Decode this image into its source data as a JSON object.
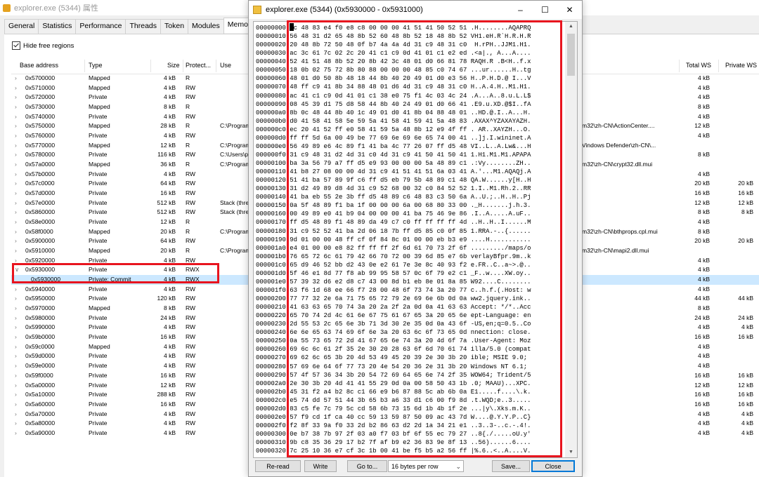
{
  "props": {
    "title": "explorer.exe (5344) 属性",
    "tabs": [
      "General",
      "Statistics",
      "Performance",
      "Threads",
      "Token",
      "Modules",
      "Memory"
    ],
    "hide_free_regions": "Hide free regions",
    "columns": {
      "base": "Base address",
      "type": "Type",
      "size": "Size",
      "protect": "Protect...",
      "use": "Use",
      "total_ws": "Total WS",
      "private_ws": "Private WS"
    },
    "rows": [
      {
        "c": ">",
        "a": "0x5700000",
        "t": "Mapped",
        "s": "4 kB",
        "p": "R",
        "u": "",
        "x": "",
        "tw": "4 kB",
        "pw": ""
      },
      {
        "c": ">",
        "a": "0x5710000",
        "t": "Mapped",
        "s": "4 kB",
        "p": "RW",
        "u": "",
        "x": "",
        "tw": "4 kB",
        "pw": ""
      },
      {
        "c": ">",
        "a": "0x5720000",
        "t": "Private",
        "s": "4 kB",
        "p": "RW",
        "u": "",
        "x": "",
        "tw": "4 kB",
        "pw": ""
      },
      {
        "c": ">",
        "a": "0x5730000",
        "t": "Mapped",
        "s": "8 kB",
        "p": "R",
        "u": "",
        "x": "",
        "tw": "8 kB",
        "pw": ""
      },
      {
        "c": ">",
        "a": "0x5740000",
        "t": "Private",
        "s": "4 kB",
        "p": "RW",
        "u": "",
        "x": "",
        "tw": "4 kB",
        "pw": ""
      },
      {
        "c": ">",
        "a": "0x5750000",
        "t": "Mapped",
        "s": "28 kB",
        "p": "R",
        "u": "C:\\Program",
        "x": "m32\\zh-CN\\ActionCenter....",
        "tw": "12 kB",
        "pw": ""
      },
      {
        "c": ">",
        "a": "0x5760000",
        "t": "Private",
        "s": "4 kB",
        "p": "RW",
        "u": "",
        "x": "",
        "tw": "4 kB",
        "pw": ""
      },
      {
        "c": ">",
        "a": "0x5770000",
        "t": "Mapped",
        "s": "12 kB",
        "p": "R",
        "u": "C:\\Program",
        "x": "Vindows Defender\\zh-CN\\...",
        "tw": "",
        "pw": ""
      },
      {
        "c": ">",
        "a": "0x5780000",
        "t": "Private",
        "s": "116 kB",
        "p": "RW",
        "u": "C:\\Users\\pa",
        "x": "",
        "tw": "8 kB",
        "pw": ""
      },
      {
        "c": ">",
        "a": "0x57a0000",
        "t": "Mapped",
        "s": "36 kB",
        "p": "R",
        "u": "C:\\Program",
        "x": "m32\\zh-CN\\crypt32.dll.mui",
        "tw": "",
        "pw": ""
      },
      {
        "c": ">",
        "a": "0x57b0000",
        "t": "Private",
        "s": "4 kB",
        "p": "RW",
        "u": "",
        "x": "",
        "tw": "4 kB",
        "pw": ""
      },
      {
        "c": ">",
        "a": "0x57c0000",
        "t": "Private",
        "s": "64 kB",
        "p": "RW",
        "u": "",
        "x": "",
        "tw": "20 kB",
        "pw": "20 kB"
      },
      {
        "c": ">",
        "a": "0x57d0000",
        "t": "Private",
        "s": "16 kB",
        "p": "RW",
        "u": "",
        "x": "",
        "tw": "16 kB",
        "pw": "16 kB"
      },
      {
        "c": ">",
        "a": "0x57e0000",
        "t": "Private",
        "s": "512 kB",
        "p": "RW",
        "u": "Stack (threa",
        "x": "",
        "tw": "12 kB",
        "pw": "12 kB"
      },
      {
        "c": ">",
        "a": "0x5860000",
        "t": "Private",
        "s": "512 kB",
        "p": "RW",
        "u": "Stack (threa",
        "x": "",
        "tw": "8 kB",
        "pw": "8 kB"
      },
      {
        "c": ">",
        "a": "0x58e0000",
        "t": "Private",
        "s": "12 kB",
        "p": "R",
        "u": "",
        "x": "",
        "tw": "4 kB",
        "pw": ""
      },
      {
        "c": ">",
        "a": "0x58f0000",
        "t": "Mapped",
        "s": "20 kB",
        "p": "R",
        "u": "C:\\Program",
        "x": "m32\\zh-CN\\bthprops.cpl.mui",
        "tw": "8 kB",
        "pw": ""
      },
      {
        "c": ">",
        "a": "0x5900000",
        "t": "Private",
        "s": "64 kB",
        "p": "RW",
        "u": "",
        "x": "",
        "tw": "20 kB",
        "pw": "20 kB"
      },
      {
        "c": ">",
        "a": "0x5910000",
        "t": "Mapped",
        "s": "20 kB",
        "p": "R",
        "u": "C:\\Program",
        "x": "m32\\zh-CN\\mapi2.dll.mui",
        "tw": "",
        "pw": ""
      },
      {
        "c": ">",
        "a": "0x5920000",
        "t": "Private",
        "s": "4 kB",
        "p": "RW",
        "u": "",
        "x": "",
        "tw": "4 kB",
        "pw": ""
      },
      {
        "c": "v",
        "a": "0x5930000",
        "t": "Private",
        "s": "4 kB",
        "p": "RWX",
        "u": "",
        "x": "",
        "tw": "4 kB",
        "pw": ""
      },
      {
        "c": "",
        "a": "0x5930000",
        "t": "Private: Commit",
        "s": "4 kB",
        "p": "RWX",
        "u": "",
        "x": "",
        "tw": "4 kB",
        "pw": "",
        "sel": true
      },
      {
        "c": ">",
        "a": "0x5940000",
        "t": "Private",
        "s": "4 kB",
        "p": "RW",
        "u": "",
        "x": "",
        "tw": "4 kB",
        "pw": ""
      },
      {
        "c": ">",
        "a": "0x5950000",
        "t": "Private",
        "s": "120 kB",
        "p": "RW",
        "u": "",
        "x": "",
        "tw": "44 kB",
        "pw": "44 kB"
      },
      {
        "c": ">",
        "a": "0x5970000",
        "t": "Mapped",
        "s": "8 kB",
        "p": "RW",
        "u": "",
        "x": "",
        "tw": "8 kB",
        "pw": ""
      },
      {
        "c": ">",
        "a": "0x5980000",
        "t": "Private",
        "s": "24 kB",
        "p": "RW",
        "u": "",
        "x": "",
        "tw": "24 kB",
        "pw": "24 kB"
      },
      {
        "c": ">",
        "a": "0x5990000",
        "t": "Private",
        "s": "4 kB",
        "p": "RW",
        "u": "",
        "x": "",
        "tw": "4 kB",
        "pw": "4 kB"
      },
      {
        "c": ">",
        "a": "0x59b0000",
        "t": "Private",
        "s": "16 kB",
        "p": "RW",
        "u": "",
        "x": "",
        "tw": "16 kB",
        "pw": "16 kB"
      },
      {
        "c": ">",
        "a": "0x59c0000",
        "t": "Mapped",
        "s": "4 kB",
        "p": "RW",
        "u": "",
        "x": "",
        "tw": "4 kB",
        "pw": ""
      },
      {
        "c": ">",
        "a": "0x59d0000",
        "t": "Private",
        "s": "4 kB",
        "p": "RW",
        "u": "",
        "x": "",
        "tw": "4 kB",
        "pw": ""
      },
      {
        "c": ">",
        "a": "0x59e0000",
        "t": "Private",
        "s": "4 kB",
        "p": "RW",
        "u": "",
        "x": "",
        "tw": "4 kB",
        "pw": ""
      },
      {
        "c": ">",
        "a": "0x59f0000",
        "t": "Private",
        "s": "16 kB",
        "p": "RW",
        "u": "",
        "x": "",
        "tw": "16 kB",
        "pw": "16 kB"
      },
      {
        "c": ">",
        "a": "0x5a00000",
        "t": "Private",
        "s": "12 kB",
        "p": "RW",
        "u": "",
        "x": "",
        "tw": "12 kB",
        "pw": "12 kB"
      },
      {
        "c": ">",
        "a": "0x5a10000",
        "t": "Private",
        "s": "288 kB",
        "p": "RW",
        "u": "",
        "x": "",
        "tw": "16 kB",
        "pw": "16 kB"
      },
      {
        "c": ">",
        "a": "0x5a60000",
        "t": "Private",
        "s": "16 kB",
        "p": "RW",
        "u": "",
        "x": "",
        "tw": "16 kB",
        "pw": "16 kB"
      },
      {
        "c": ">",
        "a": "0x5a70000",
        "t": "Private",
        "s": "4 kB",
        "p": "RW",
        "u": "",
        "x": "",
        "tw": "4 kB",
        "pw": "4 kB"
      },
      {
        "c": ">",
        "a": "0x5a80000",
        "t": "Private",
        "s": "4 kB",
        "p": "RW",
        "u": "",
        "x": "",
        "tw": "4 kB",
        "pw": "4 kB"
      },
      {
        "c": ">",
        "a": "0x5a90000",
        "t": "Private",
        "s": "4 kB",
        "p": "RW",
        "u": "",
        "x": "",
        "tw": "4 kB",
        "pw": "4 kB"
      }
    ]
  },
  "hex": {
    "title": "explorer.exe (5344) (0x5930000 - 0x5931000)",
    "lines": [
      "00000000 fc 48 83 e4 f0 e8 c8 00 00 00 41 51 41 50 52 51 .H........AQAPRQ",
      "00000010 56 48 31 d2 65 48 8b 52 60 48 8b 52 18 48 8b 52 VH1.eH.R`H.R.H.R",
      "00000020 20 48 8b 72 50 48 0f b7 4a 4a 4d 31 c9 48 31 c0  H.rPH..JJM1.H1.",
      "00000030 ac 3c 61 7c 02 2c 20 41 c1 c9 0d 41 01 c1 e2 ed .<a|., A...A....",
      "00000040 52 41 51 48 8b 52 20 8b 42 3c 48 01 d0 66 81 78 RAQH.R .B<H..f.x",
      "00000050 18 0b 02 75 72 8b 80 88 00 00 00 48 85 c0 74 67 ...ur......H..tg",
      "00000060 48 01 d0 50 8b 48 18 44 8b 40 20 49 01 d0 e3 56 H..P.H.D.@ I...V",
      "00000070 48 ff c9 41 8b 34 88 48 01 d6 4d 31 c9 48 31 c0 H..A.4.H..M1.H1.",
      "00000080 ac 41 c1 c9 0d 41 01 c1 38 e0 75 f1 4c 03 4c 24 .A...A..8.u.L.L$",
      "00000090 08 45 39 d1 75 d8 58 44 8b 40 24 49 01 d0 66 41 .E9.u.XD.@$I..fA",
      "000000a0 8b 0c 48 44 8b 40 1c 49 01 d0 41 8b 04 88 48 01 ..HD.@.I..A...H.",
      "000000b0 d0 41 58 41 58 5e 59 5a 41 58 41 59 41 5a 48 83 .AXAX^YZAXAYAZH.",
      "000000c0 ec 20 41 52 ff e0 58 41 59 5a 48 8b 12 e9 4f ff . AR..XAYZH...O.",
      "000000d0 ff ff 5d 6a 00 49 be 77 69 6e 69 6e 65 74 00 41 ..]j.I.wininet.A",
      "000000e0 56 49 89 e6 4c 89 f1 41 ba 4c 77 26 07 ff d5 48 VI..L..A.Lw&...H",
      "000000f0 31 c9 48 31 d2 4d 31 c0 4d 31 c9 41 50 41 50 41 1.H1.M1.M1.APAPA",
      "00000100 ba 3a 56 79 a7 ff d5 e9 93 00 00 00 5a 48 89 c1 .:Vy........ZH..",
      "00000110 41 b8 27 08 00 00 4d 31 c9 41 51 41 51 6a 03 41 A.'...M1.AQAQj.A",
      "00000120 51 41 ba 57 89 9f c6 ff d5 eb 79 5b 48 89 c1 48 QA.W......y[H..H",
      "00000130 31 d2 49 89 d8 4d 31 c9 52 68 00 32 c0 84 52 52 1.I..M1.Rh.2..RR",
      "00000140 41 ba eb 55 2e 3b ff d5 48 89 c6 48 83 c3 50 6a A..U.;..H..H..Pj",
      "00000150 0a 5f 48 89 f1 ba 1f 00 00 00 6a 00 68 80 33 00 ._H.......j.h.3.",
      "00000160 00 49 89 e0 41 b9 04 00 00 00 41 ba 75 46 9e 86 .I..A.....A.uF..",
      "00000170 ff d5 48 89 f1 48 89 da 49 c7 c0 ff ff ff ff 4d ..H..H..I......M",
      "00000180 31 c9 52 52 41 ba 2d 06 18 7b ff d5 85 c0 0f 85 1.RRA.-..{......",
      "00000190 9d 01 00 00 48 ff cf 0f 84 8c 01 00 00 eb b3 e9 ....H...........",
      "000001a0 e4 01 00 00 e8 82 ff ff ff 2f 6d 61 70 73 2f 6f ........./maps/o",
      "000001b0 76 65 72 6c 61 79 42 66 70 72 00 39 6d 85 e7 6b verlayBfpr.9m..k",
      "000001c0 65 d9 46 52 bb d2 43 0e e2 61 7e 3e 8c 40 93 f2 e.FR..C..a~>.@..",
      "000001d0 5f 46 e1 8d 77 f8 ab 99 95 58 57 0c 6f 79 e2 c1 _F..w....XW.oy..",
      "000001e0 57 39 32 d6 e2 d8 c7 43 00 8d b1 eb 8e 01 8a 85 W92....C........",
      "000001f0 63 f6 1d 68 ee 66 f7 28 00 48 6f 73 74 3a 20 77 c..h.f.(.Host: w",
      "00000200 77 77 32 2e 6a 71 75 65 72 79 2e 69 6e 6b 0d 0a ww2.jquery.ink..",
      "00000210 41 63 63 65 70 74 3a 20 2a 2f 2a 0d 0a 41 63 63 Accept: */*..Acc",
      "00000220 65 70 74 2d 4c 61 6e 67 75 61 67 65 3a 20 65 6e ept-Language: en",
      "00000230 2d 55 53 2c 65 6e 3b 71 3d 30 2e 35 0d 0a 43 6f -US,en;q=0.5..Co",
      "00000240 6e 6e 65 63 74 69 6f 6e 3a 20 63 6c 6f 73 65 0d nnection: close.",
      "00000250 0a 55 73 65 72 2d 41 67 65 6e 74 3a 20 4d 6f 7a .User-Agent: Moz",
      "00000260 69 6c 6c 61 2f 35 2e 30 20 28 63 6f 6d 70 61 74 illa/5.0 (compat",
      "00000270 69 62 6c 65 3b 20 4d 53 49 45 20 39 2e 30 3b 20 ible; MSIE 9.0; ",
      "00000280 57 69 6e 64 6f 77 73 20 4e 54 20 36 2e 31 3b 20 Windows NT 6.1; ",
      "00000290 57 4f 57 36 34 3b 20 54 72 69 64 65 6e 74 2f 35 WOW64; Trident/5",
      "000002a0 2e 30 3b 20 4d 41 41 55 29 0d 0a 00 58 50 43 1b .0; MAAU)...XPC.",
      "000002b0 45 31 f2 a4 b2 8c c1 66 e9 b6 87 88 5c ab 6b 0a E1.....f....\\.k.",
      "000002c0 e5 74 dd 57 51 44 3b 65 b3 a6 33 d1 c6 00 f9 8d .t.WQD;e..3.....",
      "000002d0 83 c5 fe 7c 79 5c cd 58 6b 73 15 6d 1b 4b 1f 2e ...|y\\.Xks.m.K..",
      "000002e0 57 f9 cd 1f ca 40 cc 59 13 59 87 50 09 ac 43 7d W....@.Y.Y.P..C}",
      "000002f0 f2 8f 33 9a f0 33 2d b2 86 63 d2 2d 1a 34 21 e1 ..3..3-..c.-.4!.",
      "00000300 0e b7 38 7b 97 2f 03 a0 f7 03 bf 6f 55 ec 79 27 ..8{./.....oU.y'",
      "00000310 9b c8 35 36 29 17 b2 7f af b9 e2 36 83 9e 8f 13 ..56)......6....",
      "00000320 7c 25 10 36 e7 cf 3c 1b 00 41 be f5 b5 a2 56 ff |%.6..<..A....V."
    ],
    "buttons": {
      "reread": "Re-read",
      "write": "Write",
      "goto": "Go to...",
      "bytes_per_row": "16 bytes per row",
      "save": "Save...",
      "close": "Close"
    }
  },
  "icons": {
    "minimize": "minimize-icon",
    "maximize": "maximize-icon",
    "close": "close-icon"
  }
}
